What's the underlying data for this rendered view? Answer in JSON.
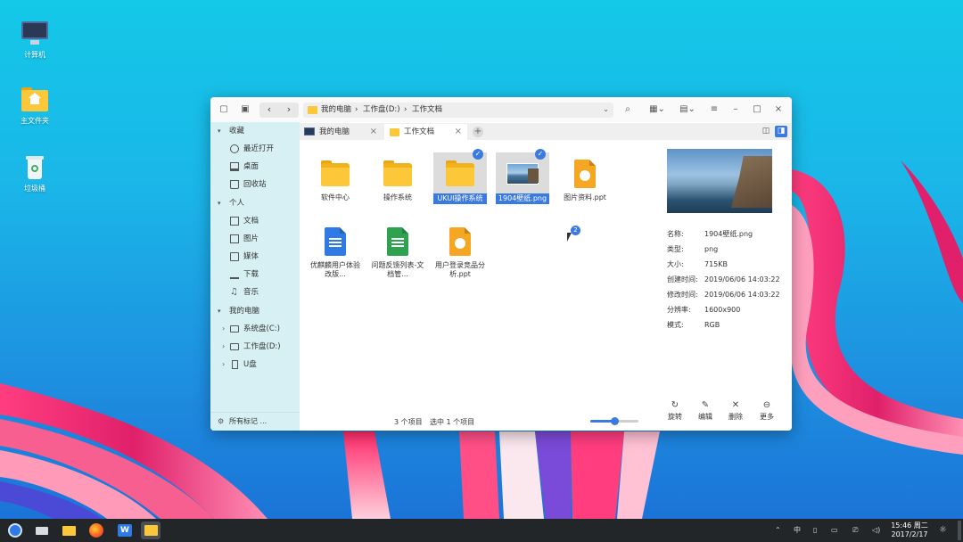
{
  "desktop": {
    "icons": [
      {
        "label": "计算机",
        "icon": "computer-icon"
      },
      {
        "label": "主文件夹",
        "icon": "home-folder-icon"
      },
      {
        "label": "垃圾桶",
        "icon": "trash-icon"
      }
    ]
  },
  "window": {
    "address": {
      "segments": [
        "我的电脑",
        "工作盘(D:)",
        "工作文档"
      ]
    },
    "tabs": [
      {
        "label": "我的电脑"
      },
      {
        "label": "工作文档"
      }
    ],
    "sidebar": {
      "sections": [
        {
          "title": "收藏",
          "items": [
            "最近打开",
            "桌面",
            "回收站"
          ]
        },
        {
          "title": "个人",
          "items": [
            "文档",
            "图片",
            "媒体",
            "下载",
            "音乐"
          ]
        },
        {
          "title": "我的电脑",
          "items": [
            "系统盘(C:)",
            "工作盘(D:)",
            "U盘"
          ]
        }
      ],
      "footer": "所有标记 ..."
    },
    "files": [
      {
        "name": "软件中心",
        "type": "folder"
      },
      {
        "name": "操作系统",
        "type": "folder"
      },
      {
        "name": "UKUI操作系统",
        "type": "folder"
      },
      {
        "name": "1904壁纸.png",
        "type": "image"
      },
      {
        "name": "图片资料.ppt",
        "type": "ppt"
      },
      {
        "name": "优麒麟用户体验改版...",
        "type": "doc"
      },
      {
        "name": "问题反馈列表-文档管...",
        "type": "sheet"
      },
      {
        "name": "用户登录竞品分析.ppt",
        "type": "ppt"
      }
    ],
    "cursor_badge": "2",
    "preview": {
      "properties": [
        {
          "key": "名称:",
          "value": "1904壁纸.png"
        },
        {
          "key": "类型:",
          "value": "png"
        },
        {
          "key": "大小:",
          "value": "715KB"
        },
        {
          "key": "创建时间:",
          "value": "2019/06/06  14:03:22"
        },
        {
          "key": "修改时间:",
          "value": "2019/06/06  14:03:22"
        },
        {
          "key": "分辨率:",
          "value": "1600x900"
        },
        {
          "key": "模式:",
          "value": "RGB"
        }
      ],
      "actions": [
        {
          "label": "旋转",
          "icon": "rotate-icon"
        },
        {
          "label": "编辑",
          "icon": "edit-icon"
        },
        {
          "label": "删除",
          "icon": "delete-icon"
        },
        {
          "label": "更多",
          "icon": "more-icon"
        }
      ]
    },
    "status": {
      "count": "3 个项目",
      "selected": "选中 1 个项目",
      "zoom_level": 0.5
    }
  },
  "taskbar": {
    "clock_time": "15:46 周二",
    "clock_date": "2017/2/17",
    "tray_ime": "中"
  },
  "colors": {
    "accent": "#3b7be0",
    "sidebar": "#d6f0f4",
    "folder": "#fcc83a",
    "taskbar": "#232629"
  }
}
